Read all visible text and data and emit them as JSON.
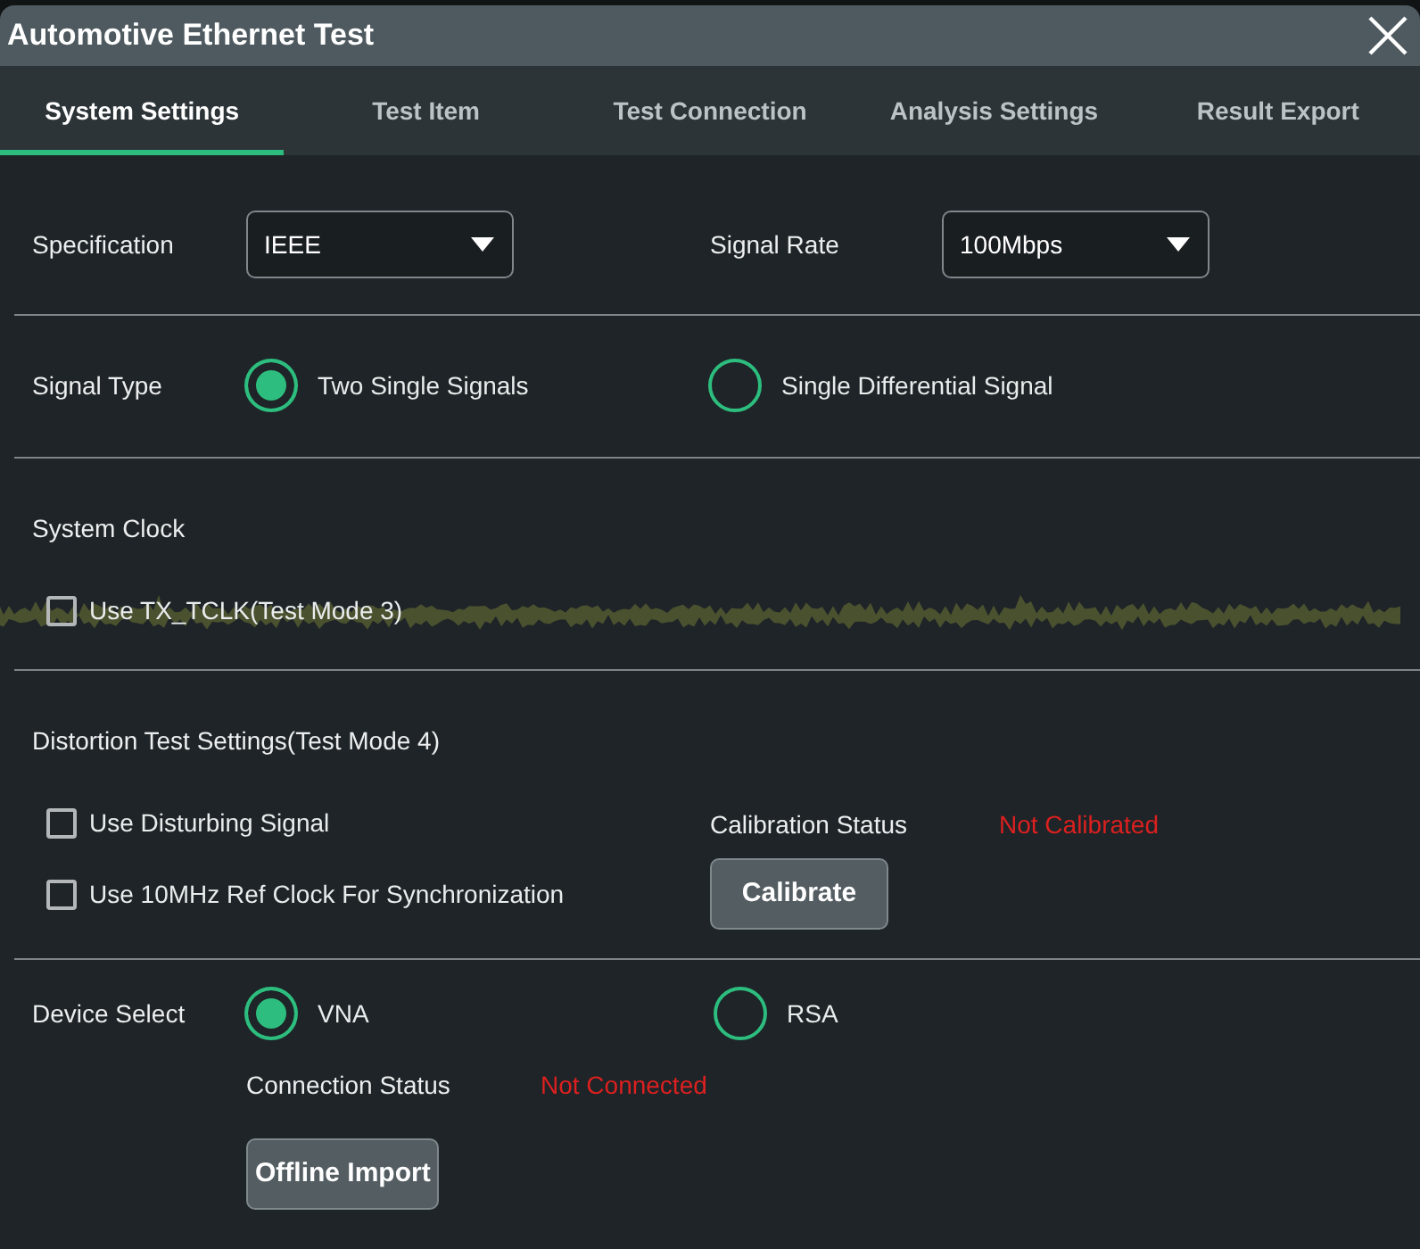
{
  "window": {
    "title": "Automotive Ethernet Test"
  },
  "tabs": [
    {
      "label": "System Settings",
      "selected": true
    },
    {
      "label": "Test Item",
      "selected": false
    },
    {
      "label": "Test Connection",
      "selected": false
    },
    {
      "label": "Analysis Settings",
      "selected": false
    },
    {
      "label": "Result Export",
      "selected": false
    }
  ],
  "specification": {
    "label": "Specification",
    "value": "IEEE"
  },
  "signal_rate": {
    "label": "Signal Rate",
    "value": "100Mbps"
  },
  "signal_type": {
    "label": "Signal Type",
    "options": [
      {
        "label": "Two Single Signals",
        "selected": true
      },
      {
        "label": "Single Differential Signal",
        "selected": false
      }
    ]
  },
  "system_clock": {
    "heading": "System Clock",
    "options": [
      {
        "label": "Use TX_TCLK(Test Mode 3)",
        "checked": false
      }
    ]
  },
  "distortion": {
    "heading": "Distortion Test Settings(Test Mode 4)",
    "options": [
      {
        "label": "Use Disturbing Signal",
        "checked": false
      },
      {
        "label": "Use 10MHz Ref Clock For Synchronization",
        "checked": false
      }
    ],
    "calibration": {
      "label": "Calibration Status",
      "status": "Not Calibrated",
      "button": "Calibrate"
    }
  },
  "device_select": {
    "label": "Device Select",
    "options": [
      {
        "label": "VNA",
        "selected": true
      },
      {
        "label": "RSA",
        "selected": false
      }
    ],
    "connection": {
      "label": "Connection Status",
      "status": "Not Connected"
    },
    "button": "Offline Import"
  }
}
